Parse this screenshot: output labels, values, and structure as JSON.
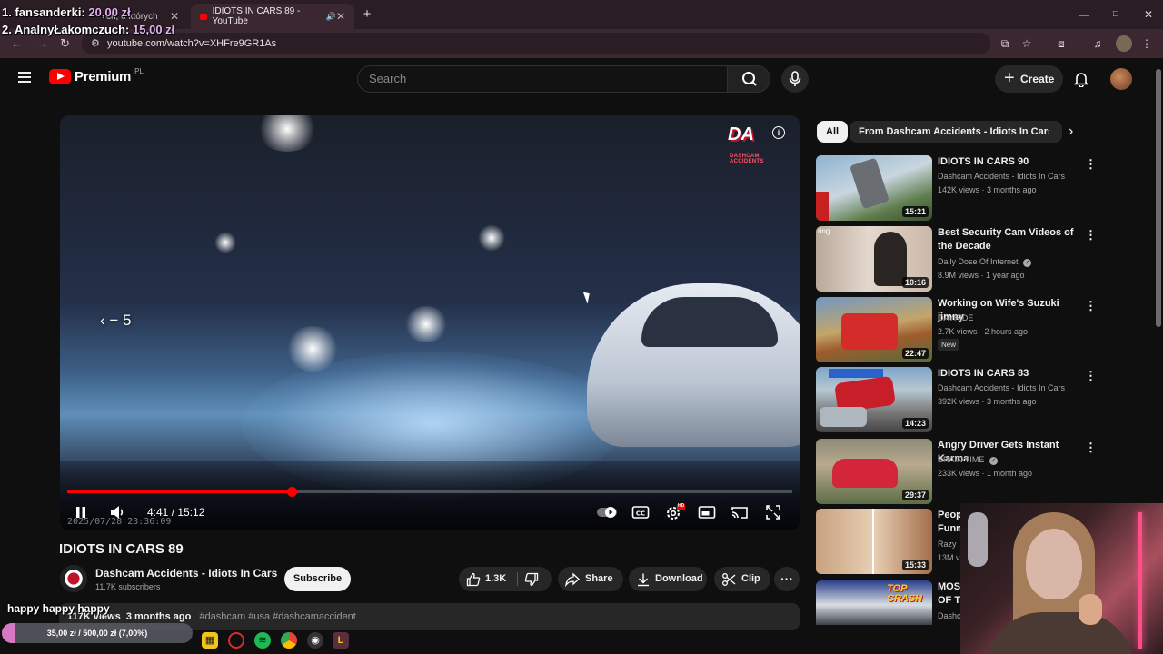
{
  "browser": {
    "tabs": [
      {
        "label": "ch, o których"
      },
      {
        "label": "IDIOTS IN CARS 89 - YouTube"
      }
    ],
    "new_tab": "+",
    "url": "youtube.com/watch?v=XHFre9GR1As",
    "window_controls": {
      "minimize": "—",
      "maximize": "□",
      "close": "✕"
    }
  },
  "overlay": {
    "donations": [
      {
        "rank_name": "1. fansanderki:",
        "amount": "20,00 zł"
      },
      {
        "rank_name": "2. AnalnyŁakomczuch:",
        "amount": "15,00 zł"
      }
    ],
    "chat_message": "happy happy happy",
    "goal": {
      "label": "35,00 zł / 500,00 zł (7,00%)",
      "progress": 0.07,
      "fill_color": "#d779c2"
    }
  },
  "header": {
    "logo_text": "Premium",
    "country": "PL",
    "search_placeholder": "Search",
    "create_label": "Create"
  },
  "player": {
    "seek_hint": "‹  − 5",
    "time_current": "4:41",
    "time_total": "15:12",
    "time_display": "4:41 / 15:12",
    "progress": 0.31,
    "watermark": "DA",
    "watermark_sub": "DASHCAM ACCIDENTS",
    "dashcam_stamp": "2025/07/28  23:36:09",
    "hd_badge": "HD",
    "accent_color": "#ff0000"
  },
  "video": {
    "title": "IDIOTS IN CARS 89",
    "channel": "Dashcam Accidents - Idiots In Cars",
    "subscribers": "11.7K subscribers",
    "subscribe_label": "Subscribe",
    "likes": "1.3K",
    "share_label": "Share",
    "download_label": "Download",
    "clip_label": "Clip",
    "views": "117K views",
    "age": "3 months ago",
    "hashtags": "#dashcam #usa #dashcamaccident"
  },
  "sidebar": {
    "chips": [
      {
        "label": "All",
        "selected": true
      },
      {
        "label": "From Dashcam Accidents - Idiots In Cars",
        "selected": false
      }
    ],
    "recommendations": [
      {
        "title": "IDIOTS IN CARS 90",
        "channel": "Dashcam Accidents - Idiots In Cars",
        "meta": "142K views · 3 months ago",
        "duration": "15:21",
        "verified": false,
        "badge": ""
      },
      {
        "title": "Best Security Cam Videos of the Decade",
        "channel": "Daily Dose Of Internet",
        "meta": "8.9M views · 1 year ago",
        "duration": "10:16",
        "verified": true,
        "badge": ""
      },
      {
        "title": "Working on Wife's Suzuki jimny",
        "channel": "DAYRIDE",
        "meta": "2.7K views · 2 hours ago",
        "duration": "22:47",
        "verified": false,
        "badge": "New"
      },
      {
        "title": "IDIOTS IN CARS 83",
        "channel": "Dashcam Accidents - Idiots In Cars",
        "meta": "392K views · 3 months ago",
        "duration": "14:23",
        "verified": false,
        "badge": ""
      },
      {
        "title": "Angry Driver Gets Instant Karma",
        "channel": "BRAIN TIME",
        "meta": "233K views · 1 month ago",
        "duration": "29:37",
        "verified": true,
        "badge": ""
      },
      {
        "title": "Peop Funn",
        "channel": "Razy",
        "meta": "13M v",
        "duration": "15:33",
        "verified": false,
        "badge": ""
      },
      {
        "title": "MOST OF TI",
        "channel": "Dashc",
        "meta": "",
        "duration": "",
        "verified": false,
        "badge": ""
      }
    ],
    "thumb_texts": {
      "ring": "ring",
      "crash": "TOP CRASH"
    }
  }
}
